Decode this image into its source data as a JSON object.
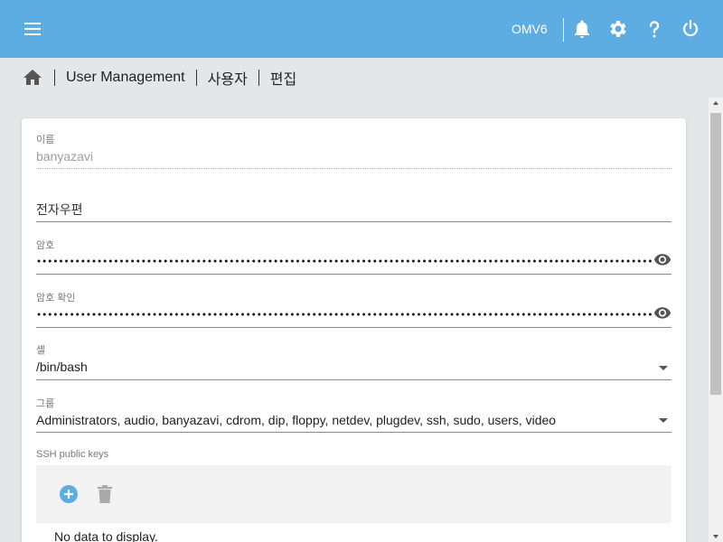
{
  "colors": {
    "accent": "#5dade2",
    "add_icon": "#5dade2"
  },
  "header": {
    "hostname": "OMV6",
    "icons": [
      "menu-icon",
      "bell-icon",
      "gear-icon",
      "help-icon",
      "power-icon"
    ]
  },
  "breadcrumb": {
    "items": [
      "User Management",
      "사용자",
      "편집"
    ]
  },
  "form": {
    "name": {
      "label": "이름",
      "value": "banyazavi"
    },
    "email": {
      "placeholder": "전자우편",
      "value": ""
    },
    "password": {
      "label": "암호"
    },
    "password_confirm": {
      "label": "암호 확인"
    },
    "shell": {
      "label": "셸",
      "value": "/bin/bash"
    },
    "groups": {
      "label": "그룹",
      "value": "Administrators, audio, banyazavi, cdrom, dip, floppy, netdev, plugdev, ssh, sudo, users, video"
    },
    "ssh": {
      "label": "SSH public keys",
      "empty_text": "No data to display."
    }
  }
}
